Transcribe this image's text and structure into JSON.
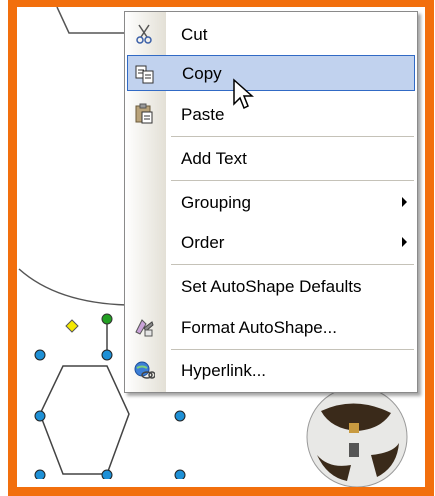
{
  "menu": {
    "items": [
      {
        "label": "Cut",
        "icon": "scissors-icon"
      },
      {
        "label": "Copy",
        "icon": "copy-icon",
        "highlighted": true
      },
      {
        "label": "Paste",
        "icon": "paste-icon"
      },
      {
        "label": "Add Text"
      },
      {
        "label": "Grouping",
        "submenu": true
      },
      {
        "label": "Order",
        "submenu": true
      },
      {
        "label": "Set AutoShape Defaults"
      },
      {
        "label": "Format AutoShape...",
        "icon": "format-autoshape-icon"
      },
      {
        "label": "Hyperlink...",
        "icon": "hyperlink-icon"
      }
    ]
  },
  "colors": {
    "frame": "#f26f0d",
    "highlight_fill": "#c1d2ee",
    "highlight_border": "#316ac5",
    "handle": "#1e90d6",
    "rotate_handle": "#22a022",
    "adjust_handle": "#f4e800"
  }
}
